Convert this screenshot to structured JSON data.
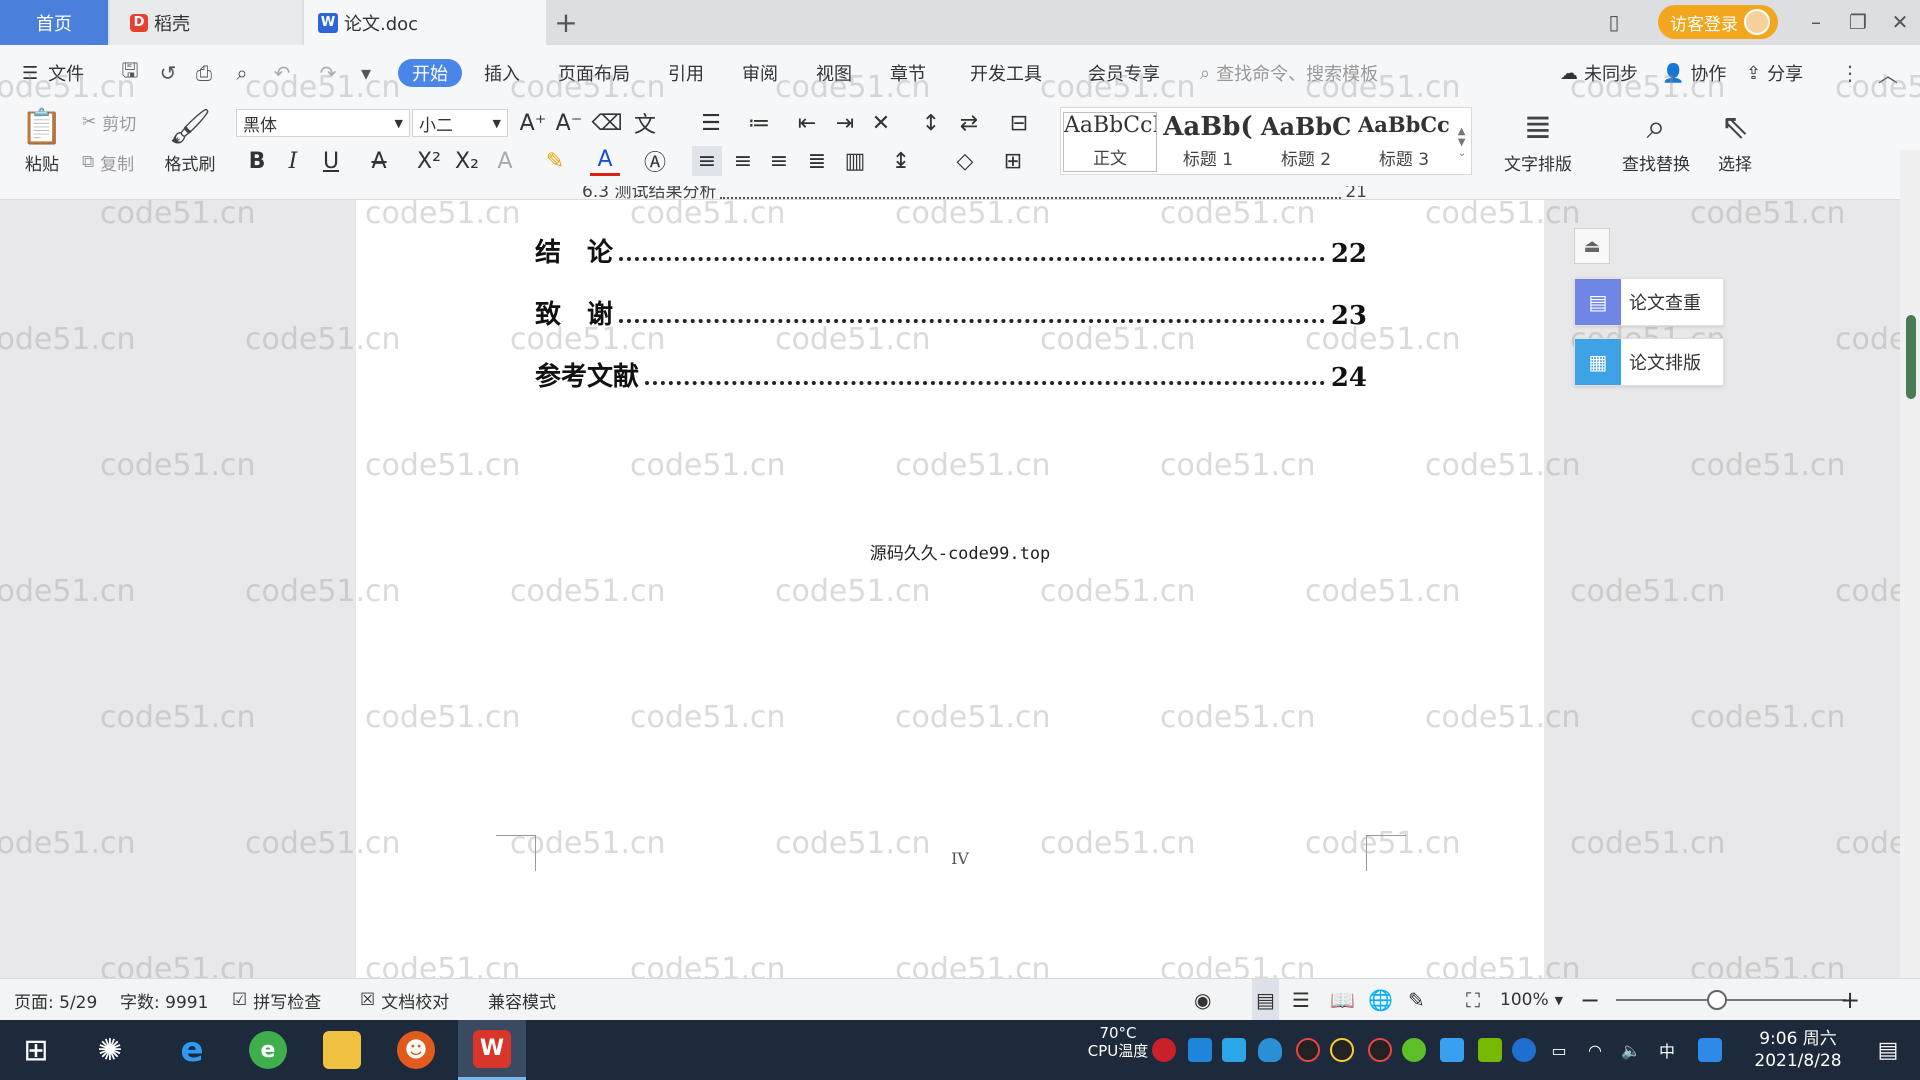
{
  "tabs": {
    "home": "首页",
    "docer": "稻壳",
    "document": "论文.doc",
    "add": "+"
  },
  "titlebar": {
    "login": "访客登录"
  },
  "menu": {
    "file": "文件",
    "items": [
      "开始",
      "插入",
      "页面布局",
      "引用",
      "审阅",
      "视图",
      "章节",
      "开发工具",
      "会员专享"
    ],
    "search_placeholder": "查找命令、搜索模板",
    "sync": "未同步",
    "collab": "协作",
    "share": "分享"
  },
  "ribbon": {
    "paste": "粘贴",
    "cut": "剪切",
    "copy": "复制",
    "format_painter": "格式刷",
    "font_name": "黑体",
    "font_size": "小二",
    "styles": [
      {
        "sample": "AaBbCcI",
        "name": "正文"
      },
      {
        "sample": "AaBb(",
        "name": "标题 1"
      },
      {
        "sample": "AaBbC",
        "name": "标题 2"
      },
      {
        "sample": "AaBbCcl",
        "name": "标题 3"
      }
    ],
    "text_layout": "文字排版",
    "find_replace": "查找替换",
    "select": "选择"
  },
  "document": {
    "prev_line": "6.3 测试结果分析",
    "prev_page": "21",
    "toc": [
      {
        "title": "结　论",
        "page": "22"
      },
      {
        "title": "致　谢",
        "page": "23"
      },
      {
        "title": "参考文献",
        "page": "24"
      }
    ],
    "footer": "源码久久-code99.top",
    "page_number": "IV",
    "watermark": "code51.cn"
  },
  "side_panel": {
    "check": "论文查重",
    "layout": "论文排版"
  },
  "status": {
    "page": "页面: 5/29",
    "words": "字数: 9991",
    "spell": "拼写检查",
    "proof": "文档校对",
    "compat": "兼容模式",
    "zoom": "100%"
  },
  "taskbar": {
    "cpu_temp": "70°C",
    "cpu_label": "CPU温度",
    "ime": "中",
    "time": "9:06 周六",
    "date": "2021/8/28"
  }
}
